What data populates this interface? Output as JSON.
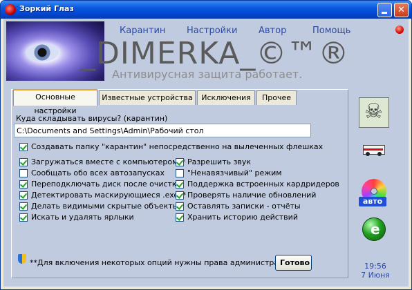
{
  "window": {
    "title": "Зоркий Глаз"
  },
  "header": {
    "nav": [
      "Карантин",
      "Настройки",
      "Автор",
      "Помощь"
    ],
    "watermark": "_DIMERKA_©™®",
    "status": "Антивирусная защита работает."
  },
  "tabs": [
    "Основные настройки",
    "Известные устройства",
    "Исключения",
    "Прочее"
  ],
  "settings": {
    "quarantine_label": "Куда складывать вирусы? (карантин)",
    "quarantine_path": "C:\\Documents and Settings\\Admin\\Рабочий стол",
    "create_folder": {
      "label": "Создавать папку \"карантин\" непосредственно на вылеченных флешках",
      "checked": true
    },
    "left_options": [
      {
        "label": "Загружаться вместе с компьютером**",
        "checked": true
      },
      {
        "label": "Сообщать обо всех автозапусках",
        "checked": false
      },
      {
        "label": "Переподключать диск после очистки",
        "checked": true
      },
      {
        "label": "Детектировать маскирующиеся .exe**",
        "checked": true
      },
      {
        "label": "Делать видимыми скрытые объекты",
        "checked": true
      },
      {
        "label": "Искать и удалять ярлыки",
        "checked": true
      }
    ],
    "right_options": [
      {
        "label": "Разрешить звук",
        "checked": true
      },
      {
        "label": "\"Ненавязчивый\" режим",
        "checked": false
      },
      {
        "label": "Поддержка встроенных кардридеров",
        "checked": true
      },
      {
        "label": "Проверять наличие обновлений",
        "checked": true
      },
      {
        "label": "Оставлять записки - отчёты",
        "checked": true
      },
      {
        "label": "Хранить историю действий",
        "checked": true
      }
    ]
  },
  "footer": {
    "note": "**Для включения некоторых опций нужны права администратора",
    "ok_label": "Готово"
  },
  "side": {
    "avto_label": "авто"
  },
  "clock": {
    "time": "19:56",
    "date": "7 Июня"
  }
}
